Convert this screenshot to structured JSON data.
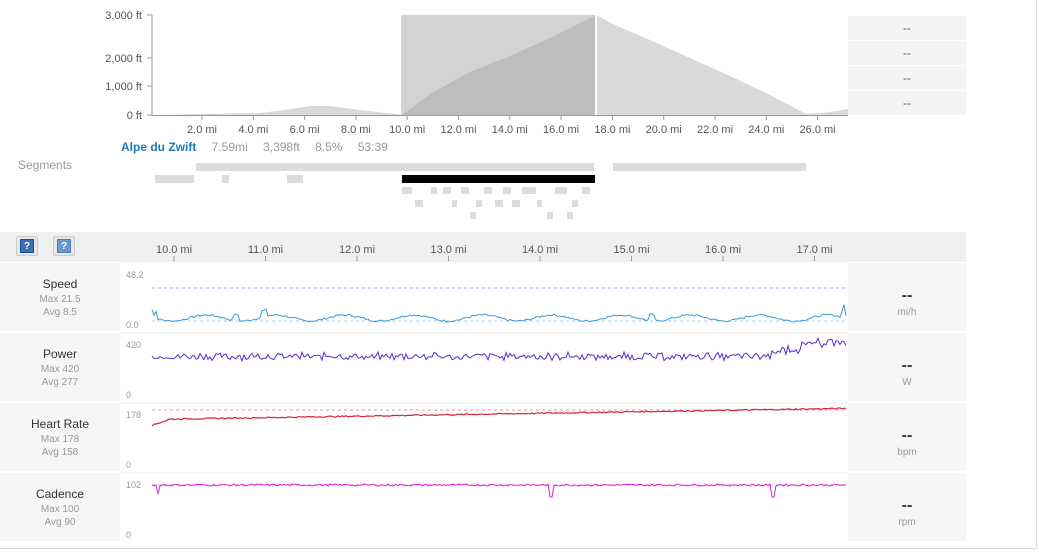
{
  "elevation": {
    "y_axis_labels": [
      "3,000 ft",
      "2,000 ft",
      "1,000 ft",
      "0 ft"
    ],
    "x_axis_labels": [
      "2.0 mi",
      "4.0 mi",
      "6.0 mi",
      "8.0 mi",
      "10.0 mi",
      "12.0 mi",
      "14.0 mi",
      "16.0 mi",
      "18.0 mi",
      "20.0 mi",
      "22.0 mi",
      "24.0 mi",
      "26.0 mi"
    ],
    "fill_color": "#d9d9d9",
    "selected_fill_color": "#bdbdbd"
  },
  "stats_panel": [
    "--",
    "--",
    "--",
    "--"
  ],
  "segments": {
    "label": "Segments",
    "selected": {
      "name": "Alpe du Zwift",
      "distance": "7.59mi",
      "elevation": "3,398ft",
      "grade": "8.5%",
      "time": "53:39"
    }
  },
  "toolbar": {
    "help_primary": "?",
    "help_secondary": "?"
  },
  "detail_axis": {
    "labels": [
      "10.0 mi",
      "11.0 mi",
      "12.0 mi",
      "13.0 mi",
      "14.0 mi",
      "15.0 mi",
      "16.0 mi",
      "17.0 mi"
    ]
  },
  "streams": [
    {
      "title": "Speed",
      "max": "Max 21.5",
      "avg": "Avg 8.5",
      "y_top": "48.2",
      "y_bottom": "0.0",
      "value": "--",
      "unit": "mi/h",
      "color": "#3b9ad9"
    },
    {
      "title": "Power",
      "max": "Max 420",
      "avg": "Avg 277",
      "y_top": "420",
      "y_bottom": "0",
      "value": "--",
      "unit": "W",
      "color": "#5b2bc9"
    },
    {
      "title": "Heart Rate",
      "max": "Max 178",
      "avg": "Avg 158",
      "y_top": "178",
      "y_bottom": "0",
      "value": "--",
      "unit": "bpm",
      "color": "#d0243c"
    },
    {
      "title": "Cadence",
      "max": "Max 100",
      "avg": "Avg 90",
      "y_top": "102",
      "y_bottom": "0",
      "value": "--",
      "unit": "rpm",
      "color": "#e01fd6"
    }
  ]
}
